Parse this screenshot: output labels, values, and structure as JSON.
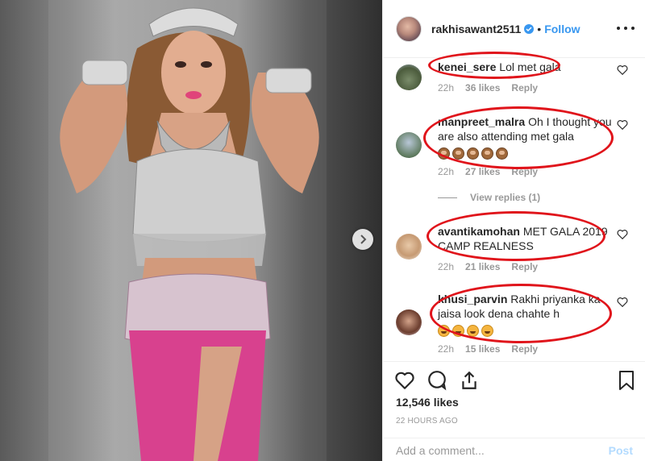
{
  "post": {
    "username": "rakhisawant2511",
    "follow_label": "Follow",
    "dot": "•"
  },
  "comments": [
    {
      "user": "kenei_sere",
      "text": "Lol met gala",
      "time": "22h",
      "likes": "36 likes",
      "reply": "Reply"
    },
    {
      "user": "manpreet_malra",
      "text": "Oh I thought you are also attending met gala",
      "emojis": "🙈🙈🙈🙈🙈",
      "time": "22h",
      "likes": "27 likes",
      "reply": "Reply"
    },
    {
      "user": "avantikamohan",
      "text": "MET GALA 2019 CAMP REALNESS",
      "time": "22h",
      "likes": "21 likes",
      "reply": "Reply"
    },
    {
      "user": "khusi_parvin",
      "text": "Rakhi priyanka ka jaisa look dena chahte h",
      "emojis": "😀😀😀😀😀😀",
      "time": "22h",
      "likes": "15 likes",
      "reply": "Reply"
    }
  ],
  "view_replies": "View replies (1)",
  "footer": {
    "likes": "12,546 likes",
    "time_ago": "22 HOURS AGO",
    "add_comment_placeholder": "Add a comment...",
    "post_label": "Post"
  },
  "icons": {
    "heart": "heart-icon",
    "comment": "comment-icon",
    "share": "share-icon",
    "bookmark": "bookmark-icon",
    "more": "more-options-icon",
    "next": "chevron-right-icon",
    "verified": "verified-badge-icon"
  },
  "colors": {
    "accent": "#3897f0",
    "highlight_oval": "#e0141b",
    "meta_grey": "#999999"
  }
}
